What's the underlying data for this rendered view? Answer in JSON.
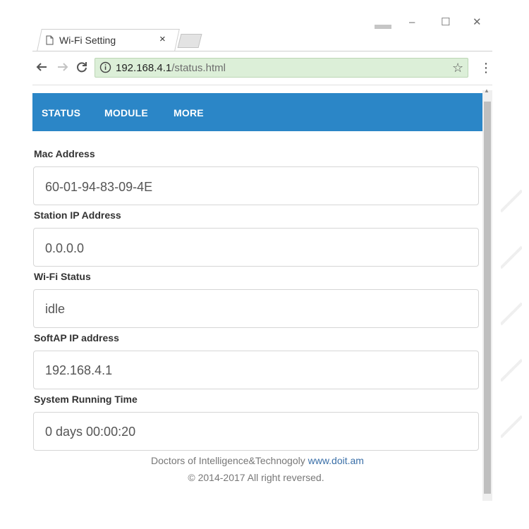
{
  "browser": {
    "tab_title": "Wi-Fi Setting",
    "tab_close": "×",
    "url_host": "192.168.4.1",
    "url_path": "/status.html",
    "icons": {
      "page": "page-icon",
      "back": "back-arrow-icon",
      "forward": "forward-arrow-icon",
      "reload": "reload-icon",
      "info": "info-icon",
      "star": "star-icon",
      "menu": "menu-dots-icon"
    }
  },
  "nav": {
    "items": [
      "STATUS",
      "MODULE",
      "MORE"
    ],
    "background": "#2b86c7"
  },
  "fields": [
    {
      "label": "Mac Address",
      "value": "60-01-94-83-09-4E"
    },
    {
      "label": "Station IP Address",
      "value": "0.0.0.0"
    },
    {
      "label": "Wi-Fi Status",
      "value": "idle"
    },
    {
      "label": "SoftAP IP address",
      "value": "192.168.4.1"
    },
    {
      "label": "System Running Time",
      "value": "0 days 00:00:20"
    }
  ],
  "footer": {
    "company": "Doctors of Intelligence&Technogoly",
    "site": "www.doit.am",
    "copyright": "© 2014-2017 All right reversed."
  }
}
